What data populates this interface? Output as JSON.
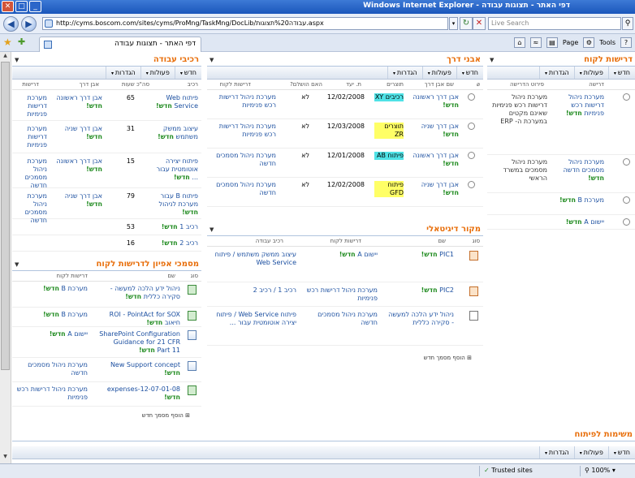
{
  "browser": {
    "title": "דפי האתר - תצוגות עבודה - Windows Internet Explorer",
    "url": "http://cyms.boscom.com/sites/cyms/ProMng/TaskMng/DocLib/עבודה%20תצוגות.aspx",
    "search_placeholder": "Live Search",
    "tab_title": "דפי האתר - תצוגות עבודה",
    "page_menu": "Page",
    "tools_menu": "Tools",
    "zone": "Trusted sites",
    "zoom": "100%"
  },
  "toolbar": {
    "new": "חדש",
    "actions": "פעולות",
    "settings": "הגדרות"
  },
  "customer_reqs": {
    "title": "דרישות לקוח",
    "col_req": "דרישה",
    "col_details": "פירוט הדרישה",
    "rows": [
      {
        "name": "מערכת ניהול דרישות רכש פנימיות",
        "details": "מערכת ניהול דרישות רכש פנימיות שאינם מקטים במערכת ה- ERP"
      },
      {
        "name": "מערכת ניהול מסמכים חדשה",
        "details": "מערכת ניהול מסמכים במשרד הראשי"
      },
      {
        "name": "מערכת B",
        "details": ""
      },
      {
        "name": "יישום A",
        "details": ""
      }
    ],
    "new_badge": "חדש!"
  },
  "milestones": {
    "title": "אבני דרך",
    "col_name": "שם אבן דרך",
    "col_outputs": "תוצרים",
    "col_date": "ת. יעד",
    "col_done": "האם הושלם?",
    "col_req": "דרישות לקוח",
    "rows": [
      {
        "name": "אבן דרך ראשונה",
        "output": "רכיבים XY",
        "date": "12/02/2008",
        "done": "לא",
        "req": "מערכת ניהול דרישות רכש פנימיות",
        "hl": "cyan"
      },
      {
        "name": "אבן דרך שניה",
        "output": "תוצרים ZR",
        "date": "12/03/2008",
        "done": "לא",
        "req": "מערכת ניהול דרישות רכש פנימיות",
        "hl": "yellow"
      },
      {
        "name": "אבן דרך ראשונה",
        "output": "פיתוח AB",
        "date": "12/01/2008",
        "done": "לא",
        "req": "מערכת ניהול מסמכים חדשה",
        "hl": "cyan"
      },
      {
        "name": "אבן דרך שניה",
        "output": "פיתוח GFD",
        "date": "12/02/2008",
        "done": "לא",
        "req": "מערכת ניהול מסמכים חדשה",
        "hl": "yellow"
      }
    ]
  },
  "digital_source": {
    "title": "מקור דיגיטאלי",
    "col_type": "סוג",
    "col_name": "שם",
    "col_req": "דרישות לקוח",
    "col_comp": "רכיב עבודה",
    "rows": [
      {
        "name": "PIC1",
        "req": "יישום A",
        "comp": "עיצוב ממשק משתמש / פיתוח Web Service"
      },
      {
        "name": "PIC2",
        "req": "מערכת ניהול דרישות רכש פנימיות",
        "comp": "רכיב 1 / רכיב 2"
      },
      {
        "name": "ניהול ידע הלכה למעשה - סקירה כללית",
        "req": "מערכת ניהול מסמכים חדשה",
        "comp": "פיתוח Web Service / פיתוח יצירה אוטומטית עבור ..."
      }
    ],
    "add_new": "הוסף מסמך חדש"
  },
  "work_components": {
    "title": "רכיבי עבודה",
    "col_comp": "רכיב",
    "col_hours": "סה\"כ שעות",
    "col_milestone": "אבן דרך",
    "col_req": "דרישות",
    "rows": [
      {
        "name": "פיתוח Web Service",
        "hours": "65",
        "milestone": "אבן דרך ראשונה",
        "req": "מערכת דרישות פנימיות"
      },
      {
        "name": "עיצוב ממשק משתמש",
        "hours": "31",
        "milestone": "אבן דרך שניה",
        "req": "מערכת דרישות פנימיות"
      },
      {
        "name": "פיתוח יצירה אוטומטית עבור ...",
        "hours": "15",
        "milestone": "אבן דרך ראשונה",
        "req": "מערכת ניהול מסמכים חדשה"
      },
      {
        "name": "פיתוח B עבור מערכת לניהול",
        "hours": "79",
        "milestone": "אבן דרך שניה",
        "req": "מערכת ניהול מסמכים חדשה"
      },
      {
        "name": "רכיב 1",
        "hours": "53",
        "milestone": "",
        "req": ""
      },
      {
        "name": "רכיב 2",
        "hours": "16",
        "milestone": "",
        "req": ""
      }
    ]
  },
  "spec_docs": {
    "title": "מסמכי אפיון לדרישות לקוח",
    "col_type": "סוג",
    "col_name": "שם",
    "col_req": "דרישות לקוח",
    "rows": [
      {
        "name": "ניהול ידע הלכה למעשה - סקירה כללית",
        "req": "מערכת B"
      },
      {
        "name": "ROI - PointAct for SOX חיאוב",
        "req": "מערכת B"
      },
      {
        "name": "SharePoint Configuration Guidance for 21 CFR Part 11",
        "req": "יישום A"
      },
      {
        "name": "New Support concept",
        "req": "מערכת ניהול מסמכים חדשה"
      },
      {
        "name": "expenses-12-07-01-08",
        "req": "מערכת ניהול דרישות רכש פנימיות"
      }
    ],
    "add_new": "הוסף מסמך חדש"
  },
  "tasks": {
    "title": "משימות לפיתוח"
  }
}
